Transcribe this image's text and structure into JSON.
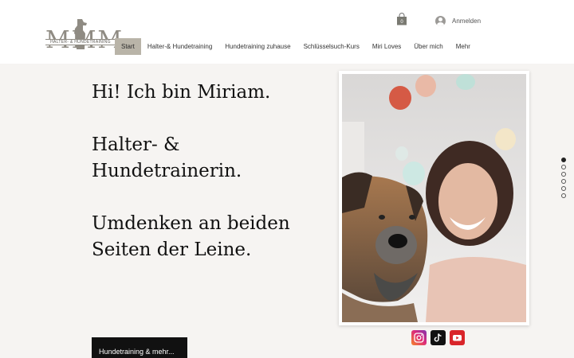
{
  "header": {
    "logo": {
      "letters": "MMM",
      "band_text": "HALTER- & HUNDETRAINING"
    },
    "login_label": "Anmelden",
    "nav": [
      {
        "label": "Start",
        "active": true
      },
      {
        "label": "Halter-& Hundetraining",
        "active": false
      },
      {
        "label": "Hundetraining zuhause",
        "active": false
      },
      {
        "label": "Schlüsselsuch-Kurs",
        "active": false
      },
      {
        "label": "Miri Loves",
        "active": false
      },
      {
        "label": "Über mich",
        "active": false
      },
      {
        "label": "Mehr",
        "active": false
      }
    ]
  },
  "hero": {
    "lines": [
      "Hi! Ich bin Miriam.",
      "Halter- & Hundetrainerin.",
      "Umdenken an beiden Seiten der Leine."
    ],
    "cta_label": "Hundetraining & mehr..."
  },
  "socials": [
    {
      "name": "instagram-icon"
    },
    {
      "name": "tiktok-icon"
    },
    {
      "name": "youtube-icon"
    }
  ],
  "slide_dots": {
    "count": 6,
    "active_index": 0
  },
  "colors": {
    "accent": "#b9b4a8",
    "background": "#f6f4f2",
    "logo_gray": "#8f8b83",
    "cta_bg": "#111111"
  }
}
